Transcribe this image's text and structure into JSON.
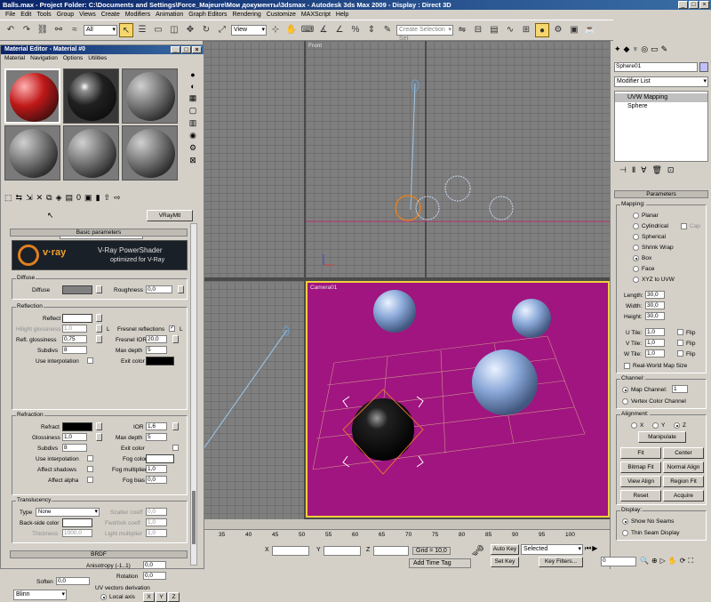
{
  "window": {
    "title": "Balls.max    - Project Folder: C:\\Documents and Settings\\Force_Majeure\\Мои документы\\3dsmax    - Autodesk 3ds Max  2009     - Display : Direct 3D",
    "min": "_",
    "max": "□",
    "close": "×"
  },
  "menu": [
    "File",
    "Edit",
    "Tools",
    "Group",
    "Views",
    "Create",
    "Modifiers",
    "Animation",
    "Graph Editors",
    "Rendering",
    "Customize",
    "MAXScript",
    "Help"
  ],
  "toolbar": {
    "filter": "All",
    "refcoord": "View",
    "selset": "Create Selection Set"
  },
  "viewports": {
    "front": "Front",
    "camera": "Camera01"
  },
  "mat_editor": {
    "title": "Material Editor - Material #0",
    "menu": [
      "Material",
      "Navigation",
      "Options",
      "Utilities"
    ],
    "material_name": "Material #0",
    "material_type": "VRayMtl",
    "basic_params": "Basic parameters",
    "vray_title": "V-Ray PowerShader",
    "vray_sub": "optimized for V-Ray",
    "vray_logo": "v·ray",
    "diffuse": {
      "group": "Diffuse",
      "diffuse": "Diffuse",
      "roughness": "Roughness",
      "roughness_val": "0,0"
    },
    "reflection": {
      "group": "Reflection",
      "reflect": "Reflect",
      "hilight": "Hilight glossiness",
      "hilight_val": "1,0",
      "L": "L",
      "refl_gloss": "Refl. glossiness",
      "refl_gloss_val": "0,75",
      "subdivs": "Subdivs",
      "subdivs_val": "8",
      "use_interp": "Use interpolation",
      "fresnel": "Fresnel reflections",
      "fresnel_ior": "Fresnel IOR",
      "fresnel_ior_val": "20,0",
      "max_depth": "Max depth",
      "max_depth_val": "5",
      "exit_color": "Exit color"
    },
    "refraction": {
      "group": "Refraction",
      "refract": "Refract",
      "ior": "IOR",
      "ior_val": "1,6",
      "gloss": "Glossiness",
      "gloss_val": "1,0",
      "max_depth": "Max depth",
      "max_depth_val": "5",
      "subdivs": "Subdivs",
      "subdivs_val": "8",
      "exit_color": "Exit color",
      "use_interp": "Use interpolation",
      "fog_color": "Fog color",
      "affect_shadows": "Affect shadows",
      "fog_mult": "Fog multiplier",
      "fog_mult_val": "1,0",
      "affect_alpha": "Affect alpha",
      "fog_bias": "Fog bias",
      "fog_bias_val": "0,0"
    },
    "translucency": {
      "group": "Translucency",
      "type": "Type",
      "type_val": "None",
      "scatter": "Scatter coeff",
      "scatter_val": "0,0",
      "backside": "Back-side color",
      "fwd": "Fwd/bck coeff",
      "fwd_val": "1,0",
      "thickness": "Thickness",
      "thickness_val": "1000,0",
      "light_mult": "Light multiplier",
      "light_mult_val": "1,0"
    },
    "brdf": {
      "header": "BRDF",
      "shader": "Blinn",
      "aniso": "Anisotropy (-1..1)",
      "aniso_val": "0,0",
      "rotation": "Rotation",
      "rotation_val": "0,0",
      "soften": "Soften",
      "soften_val": "0,0",
      "uv_vec": "UV vectors derivation",
      "local_axis": "Local axis",
      "x": "X",
      "y": "Y",
      "z": "Z"
    }
  },
  "cmd": {
    "object": "Sphere01",
    "modlist": "Modifier List",
    "stack": [
      "UVW Mapping",
      "Sphere"
    ],
    "params": "Parameters",
    "mapping": "Mapping:",
    "planar": "Planar",
    "cyl": "Cylindrical",
    "cap": "Cap",
    "spherical": "Spherical",
    "shrink": "Shrink Wrap",
    "box": "Box",
    "face": "Face",
    "xyz": "XYZ to UVW",
    "length": "Length:",
    "length_val": "30,0",
    "width": "Width:",
    "width_val": "30,0",
    "height": "Height:",
    "height_val": "30,0",
    "utile": "U Tile:",
    "utile_val": "1,0",
    "vtile": "V Tile:",
    "vtile_val": "1,0",
    "wtile": "W Tile:",
    "wtile_val": "1,0",
    "flip": "Flip",
    "realworld": "Real-World Map Size",
    "channel": "Channel:",
    "map_channel": "Map Channel:",
    "map_channel_val": "1",
    "vertex_color": "Vertex Color Channel",
    "alignment": "Alignment:",
    "ax": "X",
    "ay": "Y",
    "az": "Z",
    "manipulate": "Manipulate",
    "fit": "Fit",
    "center": "Center",
    "bitmap_fit": "Bitmap Fit",
    "normal_align": "Normal Align",
    "view_align": "View Align",
    "region_fit": "Region Fit",
    "reset": "Reset",
    "acquire": "Acquire",
    "display": "Display:",
    "show_no_seams": "Show No Seams",
    "thin_seam": "Thin Seam Display"
  },
  "bottom": {
    "ticks": [
      "35",
      "40",
      "45",
      "50",
      "55",
      "60",
      "65",
      "70",
      "75",
      "80",
      "85",
      "90",
      "95",
      "100"
    ],
    "x": "X",
    "y": "Y",
    "z": "Z",
    "grid": "Grid = 10,0",
    "autokey": "Auto Key",
    "selected": "Selected",
    "setkey": "Set Key",
    "keyfilters": "Key Filters...",
    "addtimetag": "Add Time Tag",
    "frame": "0"
  },
  "colors": {
    "title_bar": "#0a246a",
    "viewport_bg": "#7f7f7f",
    "camera_bg": "#a0157f",
    "accent": "#f5d76e"
  }
}
